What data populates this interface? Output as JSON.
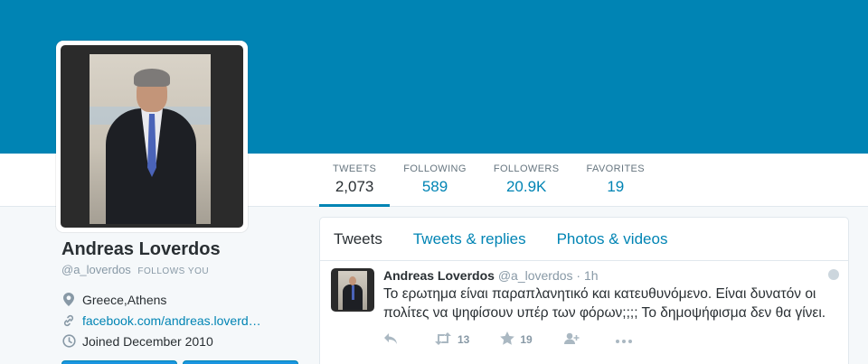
{
  "profile": {
    "name": "Andreas Loverdos",
    "handle": "@a_loverdos",
    "follows_you": "FOLLOWS YOU",
    "location": "Greece,Athens",
    "website": "facebook.com/andreas.loverd…",
    "joined": "Joined December 2010"
  },
  "stats": [
    {
      "label": "TWEETS",
      "value": "2,073"
    },
    {
      "label": "FOLLOWING",
      "value": "589"
    },
    {
      "label": "FOLLOWERS",
      "value": "20.9K"
    },
    {
      "label": "FAVORITES",
      "value": "19"
    }
  ],
  "tabs": [
    {
      "label": "Tweets"
    },
    {
      "label": "Tweets & replies"
    },
    {
      "label": "Photos & videos"
    }
  ],
  "tweet": {
    "name": "Andreas Loverdos",
    "handle": "@a_loverdos",
    "time": "· 1h",
    "text": "Το ερωτημα είναι παραπλανητικό και κατευθυνόμενο. Είναι δυνατόν οι πολίτες να ψηφίσουν υπέρ των φόρων;;;; Το δημοψήφισμα δεν θα γίνει.",
    "retweets": "13",
    "favorites": "19"
  },
  "colors": {
    "brand": "#0084b4",
    "text": "#292f33",
    "muted": "#8899a6"
  },
  "icons": [
    "location-pin-icon",
    "link-icon",
    "calendar-clock-icon",
    "reply-icon",
    "retweet-icon",
    "star-icon",
    "more-icon",
    "caret-icon"
  ]
}
